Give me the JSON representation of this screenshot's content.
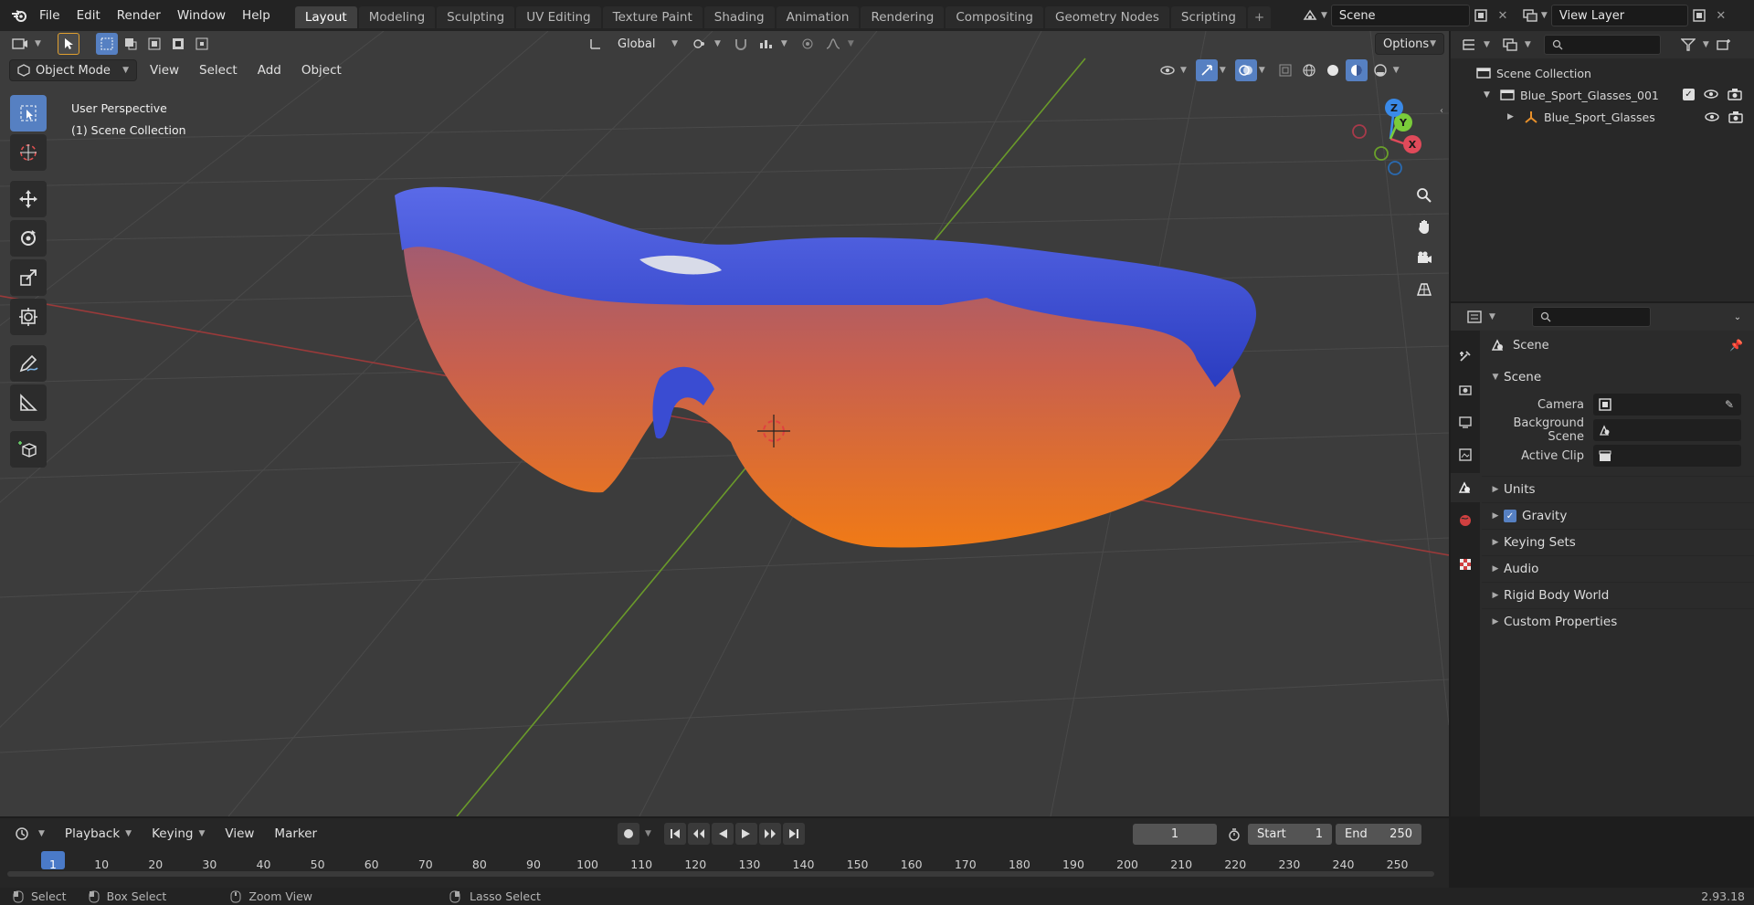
{
  "topbar": {
    "menus": [
      "File",
      "Edit",
      "Render",
      "Window",
      "Help"
    ],
    "workspaces": [
      {
        "label": "Layout",
        "active": true
      },
      {
        "label": "Modeling"
      },
      {
        "label": "Sculpting"
      },
      {
        "label": "UV Editing"
      },
      {
        "label": "Texture Paint"
      },
      {
        "label": "Shading"
      },
      {
        "label": "Animation"
      },
      {
        "label": "Rendering"
      },
      {
        "label": "Compositing"
      },
      {
        "label": "Geometry Nodes"
      },
      {
        "label": "Scripting"
      }
    ],
    "add_tab": "+",
    "scene": "Scene",
    "view_layer": "View Layer"
  },
  "viewport": {
    "mode": "Object Mode",
    "menus": [
      "View",
      "Select",
      "Add",
      "Object"
    ],
    "orientation": "Global",
    "options": "Options",
    "overlay_title": "User Perspective",
    "overlay_collection": "(1) Scene Collection",
    "gizmo": {
      "x": "X",
      "y": "Y",
      "z": "Z"
    },
    "object_colors": {
      "frame": "#3b4fd0",
      "lens_top": "#b05a6a",
      "lens_bottom": "#e8701a"
    }
  },
  "outliner": {
    "root": "Scene Collection",
    "collection": "Blue_Sport_Glasses_001",
    "object": "Blue_Sport_Glasses"
  },
  "properties": {
    "context": "Scene",
    "panel": "Scene",
    "rows": [
      {
        "label": "Camera"
      },
      {
        "label": "Background Scene"
      },
      {
        "label": "Active Clip"
      }
    ],
    "sections": [
      "Units",
      "Gravity",
      "Keying Sets",
      "Audio",
      "Rigid Body World",
      "Custom Properties"
    ],
    "gravity_checked": true
  },
  "timeline": {
    "menus": [
      "Playback",
      "Keying",
      "View",
      "Marker"
    ],
    "current_frame": "1",
    "start_label": "Start",
    "start": "1",
    "end_label": "End",
    "end": "250",
    "ticks": [
      "1",
      "10",
      "20",
      "30",
      "40",
      "50",
      "60",
      "70",
      "80",
      "90",
      "100",
      "110",
      "120",
      "130",
      "140",
      "150",
      "160",
      "170",
      "180",
      "190",
      "200",
      "210",
      "220",
      "230",
      "240",
      "250"
    ]
  },
  "status": {
    "select": "Select",
    "box_select": "Box Select",
    "zoom_view": "Zoom View",
    "lasso_select": "Lasso Select",
    "version": "2.93.18"
  }
}
